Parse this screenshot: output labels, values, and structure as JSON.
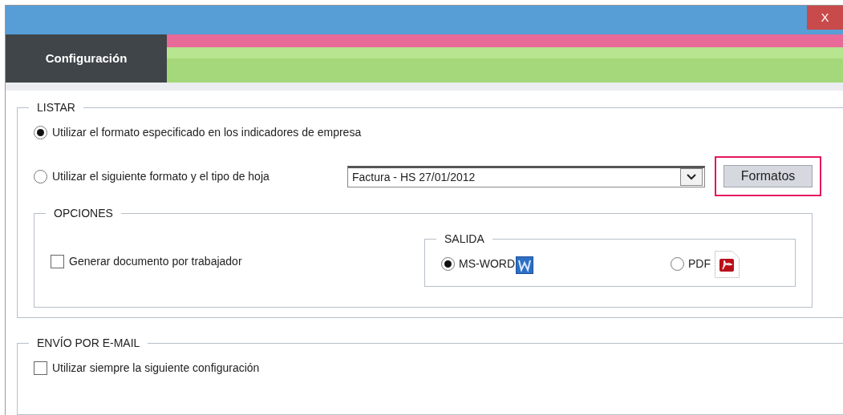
{
  "window": {
    "close_label": "X"
  },
  "tab": {
    "label": "Configuración"
  },
  "listar": {
    "legend": "LISTAR",
    "options": [
      {
        "label": "Utilizar el formato especificado en los indicadores de empresa",
        "selected": true
      },
      {
        "label": "Utilizar el siguiente formato y el tipo de hoja",
        "selected": false
      }
    ],
    "format_select": {
      "value": "Factura - HS 27/01/2012"
    },
    "formats_button": {
      "label": "Formatos",
      "highlighted": true
    },
    "opciones": {
      "legend": "OPCIONES",
      "generate_per_worker": {
        "label": "Generar documento por trabajador",
        "checked": false
      },
      "salida": {
        "legend": "SALIDA",
        "options": [
          {
            "label": "MS-WORD",
            "kind": "word",
            "selected": true
          },
          {
            "label": "PDF",
            "kind": "pdf",
            "selected": false
          }
        ]
      }
    }
  },
  "email": {
    "legend": "ENVÍO POR E-MAIL",
    "always_use": {
      "label": "Utilizar siempre la siguiente configuración",
      "checked": false
    }
  }
}
